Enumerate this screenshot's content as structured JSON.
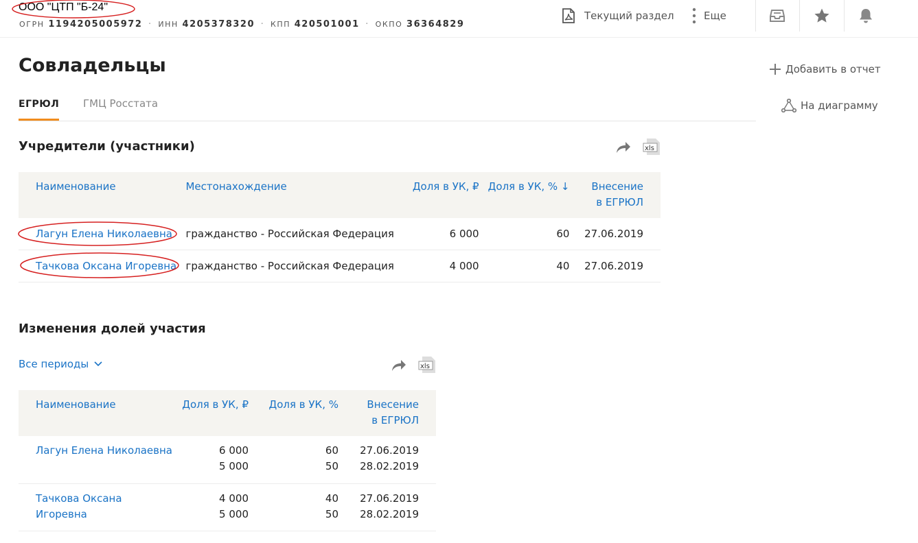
{
  "company": {
    "name": "ООО \"ЦТП \"Б-24\"",
    "ogrn_label": "ОГРН",
    "ogrn": "1194205005972",
    "inn_label": "ИНН",
    "inn": "4205378320",
    "kpp_label": "КПП",
    "kpp": "420501001",
    "okpo_label": "ОКПО",
    "okpo": "36364829"
  },
  "topbar": {
    "section_label": "Текущий раздел",
    "more_label": "Еще",
    "icons": [
      "pdf-icon",
      "kebab-icon",
      "inbox-icon",
      "star-icon",
      "bell-icon"
    ]
  },
  "page": {
    "title": "Совладельцы",
    "tabs": [
      {
        "label": "ЕГРЮЛ",
        "active": true
      },
      {
        "label": "ГМЦ Росстата",
        "active": false
      }
    ],
    "side_actions": {
      "add_report": "Добавить в отчет",
      "diagram": "На диаграмму"
    }
  },
  "founders": {
    "title": "Учредители (участники)",
    "columns": [
      "Наименование",
      "Местонахождение",
      "Доля в УК, ₽",
      "Доля в УК, % ↓",
      "Внесение в ЕГРЮЛ"
    ],
    "rows": [
      {
        "name": "Лагун Елена Николаевна",
        "location": "гражданство - Российская Федерация",
        "share_rub": "6 000",
        "share_pct": "60",
        "date": "27.06.2019"
      },
      {
        "name": "Тачкова Оксана Игоревна",
        "location": "гражданство - Российская Федерация",
        "share_rub": "4 000",
        "share_pct": "40",
        "date": "27.06.2019"
      }
    ]
  },
  "changes": {
    "title": "Изменения долей участия",
    "period_filter": "Все периоды",
    "columns": [
      "Наименование",
      "Доля в УК, ₽",
      "Доля в УК, %",
      "Внесение в ЕГРЮЛ"
    ],
    "rows": [
      {
        "name": "Лагун Елена Николаевна",
        "share_rub": [
          "6 000",
          "5 000"
        ],
        "share_pct": [
          "60",
          "50"
        ],
        "date": [
          "27.06.2019",
          "28.02.2019"
        ]
      },
      {
        "name": "Тачкова Оксана Игоревна",
        "share_rub": [
          "4 000",
          "5 000"
        ],
        "share_pct": [
          "40",
          "50"
        ],
        "date": [
          "27.06.2019",
          "28.02.2019"
        ]
      }
    ]
  },
  "colors": {
    "accent": "#f08c1e",
    "link": "#1a73c6",
    "annotation": "#d62020"
  }
}
